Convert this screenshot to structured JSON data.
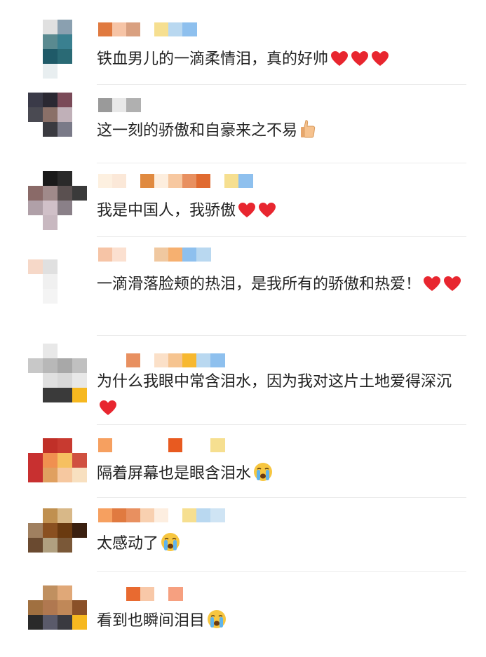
{
  "comments": [
    {
      "text": "铁血男儿的一滴柔情泪，真的好帅",
      "emoji": [
        "heart",
        "heart",
        "heart"
      ],
      "avatar_colors": [
        "#ffffff",
        "#e0e0e0",
        "#8aa0b0",
        "#ffffff",
        "#ffffff",
        "#5a8a90",
        "#3a8090",
        "#ffffff",
        "#ffffff",
        "#1f5a68",
        "#2a6a75",
        "#ffffff",
        "#ffffff",
        "#e8eef0",
        "#ffffff",
        "#ffffff"
      ],
      "name_colors": [
        "#e07a40",
        "#f6c4a6",
        "#d9a080",
        "#ffffff",
        "#f6df90",
        "#b9d8f0",
        "#8ec0ee"
      ]
    },
    {
      "text": "这一刻的骄傲和自豪来之不易",
      "emoji": [
        "thumb"
      ],
      "avatar_colors": [
        "#3a3a48",
        "#2a2832",
        "#7a4a58",
        "#ffffff",
        "#4a4a52",
        "#8a7068",
        "#c0b0b8",
        "#ffffff",
        "#ffffff",
        "#3a3a40",
        "#7a7a88",
        "#ffffff",
        "#ffffff",
        "#ffffff",
        "#ffffff",
        "#ffffff"
      ],
      "name_colors": [
        "#9a9a9a",
        "#e8e8e8",
        "#b0b0b0"
      ]
    },
    {
      "text": "我是中国人，我骄傲",
      "emoji": [
        "heart",
        "heart"
      ],
      "avatar_colors": [
        "#ffffff",
        "#1a1a1a",
        "#2a2a2a",
        "#ffffff",
        "#8a6a68",
        "#a08a8a",
        "#5a5050",
        "#3a3a3a",
        "#b0a0a8",
        "#d0c0c8",
        "#8a8088",
        "#ffffff",
        "#ffffff",
        "#c8b8c0",
        "#ffffff",
        "#ffffff"
      ],
      "name_colors": [
        "#fdf0e0",
        "#fbe8d8",
        "#ffffff",
        "#e08a40",
        "#fdeede",
        "#f7c8a0",
        "#e89060",
        "#e06a30",
        "#ffffff",
        "#f6df90",
        "#8ec0ee"
      ]
    },
    {
      "text": "一滴滑落脸颊的热泪，是我所有的骄傲和热爱！",
      "emoji": [
        "heart",
        "heart"
      ],
      "avatar_colors": [
        "#ffffff",
        "#ffffff",
        "#ffffff",
        "#ffffff",
        "#f6d8c8",
        "#e0e0e0",
        "#ffffff",
        "#ffffff",
        "#ffffff",
        "#f0f0f0",
        "#ffffff",
        "#ffffff",
        "#ffffff",
        "#f4f4f4",
        "#ffffff",
        "#ffffff"
      ],
      "name_colors": [
        "#f6c4a6",
        "#fbe0d0",
        "#ffffff",
        "#ffffff",
        "#f0c8a0",
        "#f6b070",
        "#8ec0ee",
        "#b9d8f0"
      ]
    },
    {
      "text": "为什么我眼中常含泪水，因为我对这片土地爱得深沉",
      "emoji": [
        "heart"
      ],
      "avatar_colors": [
        "#ffffff",
        "#e8e8e8",
        "#ffffff",
        "#ffffff",
        "#c8c8c8",
        "#b8b8b8",
        "#a8a8a8",
        "#c0c0c0",
        "#ffffff",
        "#e0e0e0",
        "#d8d8d8",
        "#e8e8e8",
        "#ffffff",
        "#3a3a3a",
        "#3a3a3a",
        "#f6b820"
      ],
      "name_colors": [
        "#ffffff",
        "#ffffff",
        "#e89060",
        "#ffffff",
        "#fbe0c8",
        "#f6c490",
        "#f7b830",
        "#b9d8f0",
        "#8ec0ee"
      ]
    },
    {
      "text": "隔着屏幕也是眼含泪水",
      "emoji": [
        "cry"
      ],
      "avatar_colors": [
        "#ffffff",
        "#c03028",
        "#c83a30",
        "#ffffff",
        "#c83030",
        "#f09050",
        "#f6c060",
        "#d05040",
        "#c83030",
        "#e0a060",
        "#f6c8a0",
        "#f8e0c0",
        "#ffffff",
        "#ffffff",
        "#ffffff",
        "#ffffff"
      ],
      "name_colors": [
        "#f6a060",
        "#ffffff",
        "#ffffff",
        "#ffffff",
        "#ffffff",
        "#e85a20",
        "#ffffff",
        "#ffffff",
        "#f6df90"
      ]
    },
    {
      "text": "太感动了",
      "emoji": [
        "cry"
      ],
      "avatar_colors": [
        "#ffffff",
        "#c09050",
        "#d8b888",
        "#ffffff",
        "#a08060",
        "#8a5020",
        "#6a3a10",
        "#3a2010",
        "#6a4a30",
        "#b0a080",
        "#7a5838",
        "#ffffff",
        "#ffffff",
        "#ffffff",
        "#ffffff",
        "#ffffff"
      ],
      "name_colors": [
        "#f6a060",
        "#e07a40",
        "#e89060",
        "#f8d0b0",
        "#fdeee0",
        "#ffffff",
        "#f6df90",
        "#b9d8f0",
        "#cfe4f4"
      ]
    },
    {
      "text": "看到也瞬间泪目",
      "emoji": [
        "cry"
      ],
      "avatar_colors": [
        "#ffffff",
        "#c09060",
        "#e0a878",
        "#ffffff",
        "#a07040",
        "#b07850",
        "#c08858",
        "#8a5028",
        "#2a2a2a",
        "#5a5a6a",
        "#3a3a40",
        "#f6b820",
        "#ffffff",
        "#ffffff",
        "#ffffff",
        "#ffffff"
      ],
      "name_colors": [
        "#ffffff",
        "#ffffff",
        "#e86a30",
        "#f8c8a8",
        "#ffffff",
        "#f6a080"
      ]
    }
  ]
}
